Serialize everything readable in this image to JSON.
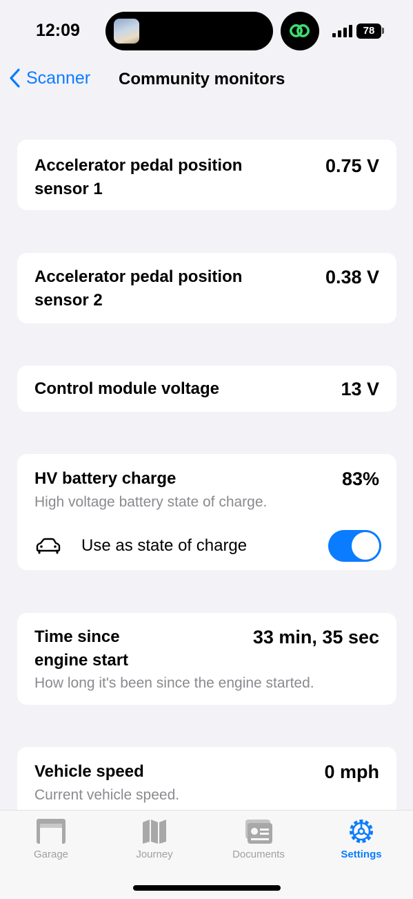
{
  "status_bar": {
    "time": "12:09",
    "battery": "78"
  },
  "nav": {
    "back_label": "Scanner",
    "title": "Community monitors"
  },
  "monitors": [
    {
      "label_line1": "Accelerator pedal position",
      "label_line2": "sensor 1",
      "value": "0.75 V"
    },
    {
      "label_line1": "Accelerator pedal position",
      "label_line2": "sensor 2",
      "value": "0.38 V"
    },
    {
      "label_line1": "Control module voltage",
      "value": "13 V"
    },
    {
      "label_line1": "HV battery charge",
      "value": "83%",
      "description": "High voltage battery state of charge.",
      "toggle_label": "Use as state of charge",
      "toggle_on": true
    },
    {
      "label_line1": "Time since",
      "label_line2": "engine start",
      "value": "33 min, 35 sec",
      "description": "How long it's been since the engine started."
    },
    {
      "label_line1": "Vehicle speed",
      "value": "0 mph",
      "description": "Current vehicle speed."
    }
  ],
  "tabs": [
    {
      "label": "Garage",
      "icon": "garage-icon"
    },
    {
      "label": "Journey",
      "icon": "map-icon"
    },
    {
      "label": "Documents",
      "icon": "documents-icon"
    },
    {
      "label": "Settings",
      "icon": "gear-icon",
      "active": true
    }
  ],
  "colors": {
    "accent": "#0a7cff",
    "background": "#f2f2f7",
    "secondary_text": "#8a8a8f",
    "inactive_tab": "#a0a0a0"
  }
}
